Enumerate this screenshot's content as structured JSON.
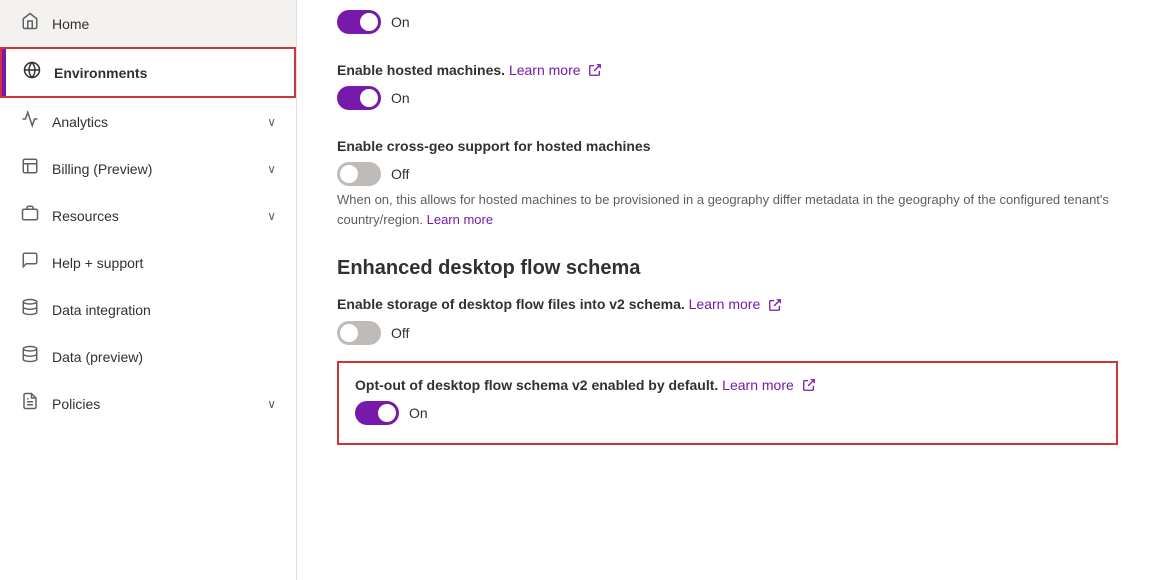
{
  "sidebar": {
    "items": [
      {
        "id": "home",
        "label": "Home",
        "icon": "🏠",
        "hasChevron": false,
        "active": false
      },
      {
        "id": "environments",
        "label": "Environments",
        "icon": "🌐",
        "hasChevron": false,
        "active": true
      },
      {
        "id": "analytics",
        "label": "Analytics",
        "icon": "📈",
        "hasChevron": true,
        "active": false
      },
      {
        "id": "billing",
        "label": "Billing (Preview)",
        "icon": "🖼",
        "hasChevron": true,
        "active": false
      },
      {
        "id": "resources",
        "label": "Resources",
        "icon": "🖼",
        "hasChevron": true,
        "active": false
      },
      {
        "id": "help",
        "label": "Help + support",
        "icon": "🎧",
        "hasChevron": false,
        "active": false
      },
      {
        "id": "data-integration",
        "label": "Data integration",
        "icon": "🔗",
        "hasChevron": false,
        "active": false
      },
      {
        "id": "data-preview",
        "label": "Data (preview)",
        "icon": "🔗",
        "hasChevron": false,
        "active": false
      },
      {
        "id": "policies",
        "label": "Policies",
        "icon": "📄",
        "hasChevron": true,
        "active": false
      }
    ]
  },
  "main": {
    "sections": [
      {
        "id": "top-toggle",
        "type": "toggle-only",
        "toggleState": "on",
        "toggleLabel": "On"
      },
      {
        "id": "hosted-machines",
        "type": "toggle-setting",
        "label": "Enable hosted machines.",
        "learnMore": "Learn more",
        "toggleState": "on",
        "toggleLabel": "On"
      },
      {
        "id": "cross-geo",
        "type": "toggle-setting-description",
        "label": "Enable cross-geo support for hosted machines",
        "toggleState": "off",
        "toggleLabel": "Off",
        "description": "When on, this allows for hosted machines to be provisioned in a geography differ metadata in the geography of the configured tenant's country/region.",
        "descriptionLearnMore": "Learn more"
      },
      {
        "id": "enhanced-desktop-flow",
        "type": "section-header",
        "title": "Enhanced desktop flow schema"
      },
      {
        "id": "storage-desktop",
        "type": "toggle-setting",
        "label": "Enable storage of desktop flow files into v2 schema.",
        "learnMore": "Learn more",
        "toggleState": "off",
        "toggleLabel": "Off"
      },
      {
        "id": "opt-out-desktop",
        "type": "toggle-setting-highlighted",
        "label": "Opt-out of desktop flow schema v2 enabled by default.",
        "learnMore": "Learn more",
        "toggleState": "on",
        "toggleLabel": "On",
        "highlighted": true
      }
    ]
  }
}
